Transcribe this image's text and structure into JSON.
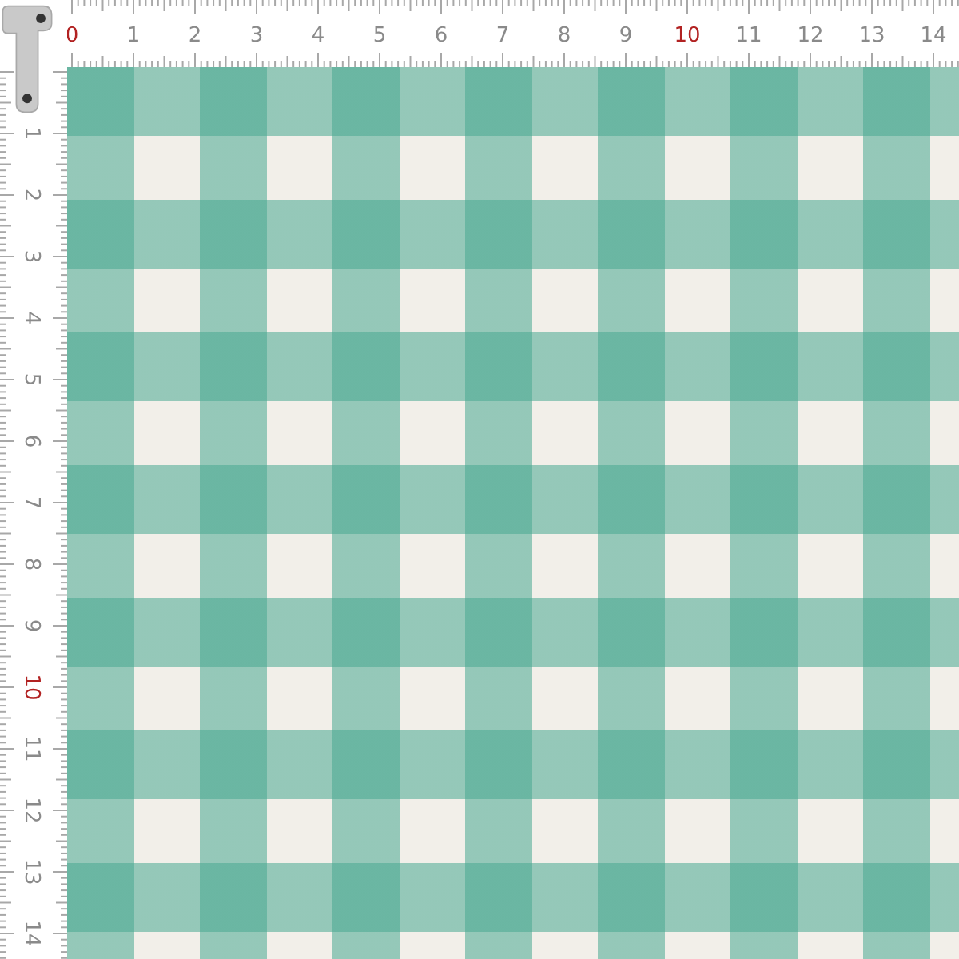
{
  "top_ruler": {
    "labels": [
      {
        "text": "0",
        "highlighted": true
      },
      {
        "text": "1",
        "highlighted": false
      },
      {
        "text": "2",
        "highlighted": false
      },
      {
        "text": "3",
        "highlighted": false
      },
      {
        "text": "4",
        "highlighted": false
      },
      {
        "text": "5",
        "highlighted": false
      },
      {
        "text": "6",
        "highlighted": false
      },
      {
        "text": "7",
        "highlighted": false
      },
      {
        "text": "8",
        "highlighted": false
      },
      {
        "text": "9",
        "highlighted": false
      },
      {
        "text": "10",
        "highlighted": true
      },
      {
        "text": "11",
        "highlighted": false
      },
      {
        "text": "12",
        "highlighted": false
      },
      {
        "text": "13",
        "highlighted": false
      },
      {
        "text": "14",
        "highlighted": false
      }
    ]
  },
  "left_ruler": {
    "labels": [
      {
        "text": "1",
        "highlighted": false
      },
      {
        "text": "2",
        "highlighted": false
      },
      {
        "text": "3",
        "highlighted": false
      },
      {
        "text": "4",
        "highlighted": false
      },
      {
        "text": "5",
        "highlighted": false
      },
      {
        "text": "6",
        "highlighted": false
      },
      {
        "text": "7",
        "highlighted": false
      },
      {
        "text": "8",
        "highlighted": false
      },
      {
        "text": "9",
        "highlighted": false
      },
      {
        "text": "10",
        "highlighted": true
      },
      {
        "text": "11",
        "highlighted": false
      },
      {
        "text": "12",
        "highlighted": false
      },
      {
        "text": "13",
        "highlighted": false
      },
      {
        "text": "14",
        "highlighted": false
      }
    ]
  }
}
